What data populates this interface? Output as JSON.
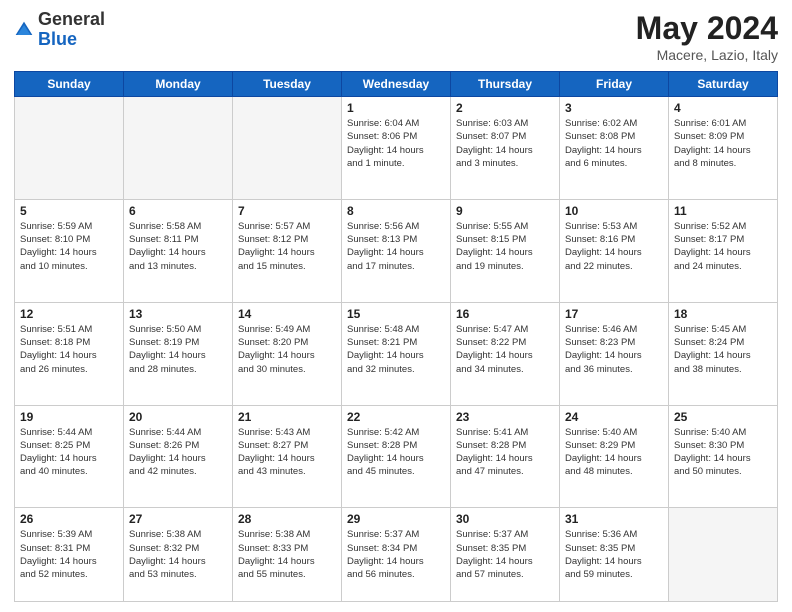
{
  "header": {
    "logo_general": "General",
    "logo_blue": "Blue",
    "month_title": "May 2024",
    "location": "Macere, Lazio, Italy"
  },
  "weekdays": [
    "Sunday",
    "Monday",
    "Tuesday",
    "Wednesday",
    "Thursday",
    "Friday",
    "Saturday"
  ],
  "weeks": [
    [
      {
        "day": "",
        "info": ""
      },
      {
        "day": "",
        "info": ""
      },
      {
        "day": "",
        "info": ""
      },
      {
        "day": "1",
        "info": "Sunrise: 6:04 AM\nSunset: 8:06 PM\nDaylight: 14 hours\nand 1 minute."
      },
      {
        "day": "2",
        "info": "Sunrise: 6:03 AM\nSunset: 8:07 PM\nDaylight: 14 hours\nand 3 minutes."
      },
      {
        "day": "3",
        "info": "Sunrise: 6:02 AM\nSunset: 8:08 PM\nDaylight: 14 hours\nand 6 minutes."
      },
      {
        "day": "4",
        "info": "Sunrise: 6:01 AM\nSunset: 8:09 PM\nDaylight: 14 hours\nand 8 minutes."
      }
    ],
    [
      {
        "day": "5",
        "info": "Sunrise: 5:59 AM\nSunset: 8:10 PM\nDaylight: 14 hours\nand 10 minutes."
      },
      {
        "day": "6",
        "info": "Sunrise: 5:58 AM\nSunset: 8:11 PM\nDaylight: 14 hours\nand 13 minutes."
      },
      {
        "day": "7",
        "info": "Sunrise: 5:57 AM\nSunset: 8:12 PM\nDaylight: 14 hours\nand 15 minutes."
      },
      {
        "day": "8",
        "info": "Sunrise: 5:56 AM\nSunset: 8:13 PM\nDaylight: 14 hours\nand 17 minutes."
      },
      {
        "day": "9",
        "info": "Sunrise: 5:55 AM\nSunset: 8:15 PM\nDaylight: 14 hours\nand 19 minutes."
      },
      {
        "day": "10",
        "info": "Sunrise: 5:53 AM\nSunset: 8:16 PM\nDaylight: 14 hours\nand 22 minutes."
      },
      {
        "day": "11",
        "info": "Sunrise: 5:52 AM\nSunset: 8:17 PM\nDaylight: 14 hours\nand 24 minutes."
      }
    ],
    [
      {
        "day": "12",
        "info": "Sunrise: 5:51 AM\nSunset: 8:18 PM\nDaylight: 14 hours\nand 26 minutes."
      },
      {
        "day": "13",
        "info": "Sunrise: 5:50 AM\nSunset: 8:19 PM\nDaylight: 14 hours\nand 28 minutes."
      },
      {
        "day": "14",
        "info": "Sunrise: 5:49 AM\nSunset: 8:20 PM\nDaylight: 14 hours\nand 30 minutes."
      },
      {
        "day": "15",
        "info": "Sunrise: 5:48 AM\nSunset: 8:21 PM\nDaylight: 14 hours\nand 32 minutes."
      },
      {
        "day": "16",
        "info": "Sunrise: 5:47 AM\nSunset: 8:22 PM\nDaylight: 14 hours\nand 34 minutes."
      },
      {
        "day": "17",
        "info": "Sunrise: 5:46 AM\nSunset: 8:23 PM\nDaylight: 14 hours\nand 36 minutes."
      },
      {
        "day": "18",
        "info": "Sunrise: 5:45 AM\nSunset: 8:24 PM\nDaylight: 14 hours\nand 38 minutes."
      }
    ],
    [
      {
        "day": "19",
        "info": "Sunrise: 5:44 AM\nSunset: 8:25 PM\nDaylight: 14 hours\nand 40 minutes."
      },
      {
        "day": "20",
        "info": "Sunrise: 5:44 AM\nSunset: 8:26 PM\nDaylight: 14 hours\nand 42 minutes."
      },
      {
        "day": "21",
        "info": "Sunrise: 5:43 AM\nSunset: 8:27 PM\nDaylight: 14 hours\nand 43 minutes."
      },
      {
        "day": "22",
        "info": "Sunrise: 5:42 AM\nSunset: 8:28 PM\nDaylight: 14 hours\nand 45 minutes."
      },
      {
        "day": "23",
        "info": "Sunrise: 5:41 AM\nSunset: 8:28 PM\nDaylight: 14 hours\nand 47 minutes."
      },
      {
        "day": "24",
        "info": "Sunrise: 5:40 AM\nSunset: 8:29 PM\nDaylight: 14 hours\nand 48 minutes."
      },
      {
        "day": "25",
        "info": "Sunrise: 5:40 AM\nSunset: 8:30 PM\nDaylight: 14 hours\nand 50 minutes."
      }
    ],
    [
      {
        "day": "26",
        "info": "Sunrise: 5:39 AM\nSunset: 8:31 PM\nDaylight: 14 hours\nand 52 minutes."
      },
      {
        "day": "27",
        "info": "Sunrise: 5:38 AM\nSunset: 8:32 PM\nDaylight: 14 hours\nand 53 minutes."
      },
      {
        "day": "28",
        "info": "Sunrise: 5:38 AM\nSunset: 8:33 PM\nDaylight: 14 hours\nand 55 minutes."
      },
      {
        "day": "29",
        "info": "Sunrise: 5:37 AM\nSunset: 8:34 PM\nDaylight: 14 hours\nand 56 minutes."
      },
      {
        "day": "30",
        "info": "Sunrise: 5:37 AM\nSunset: 8:35 PM\nDaylight: 14 hours\nand 57 minutes."
      },
      {
        "day": "31",
        "info": "Sunrise: 5:36 AM\nSunset: 8:35 PM\nDaylight: 14 hours\nand 59 minutes."
      },
      {
        "day": "",
        "info": ""
      }
    ]
  ]
}
